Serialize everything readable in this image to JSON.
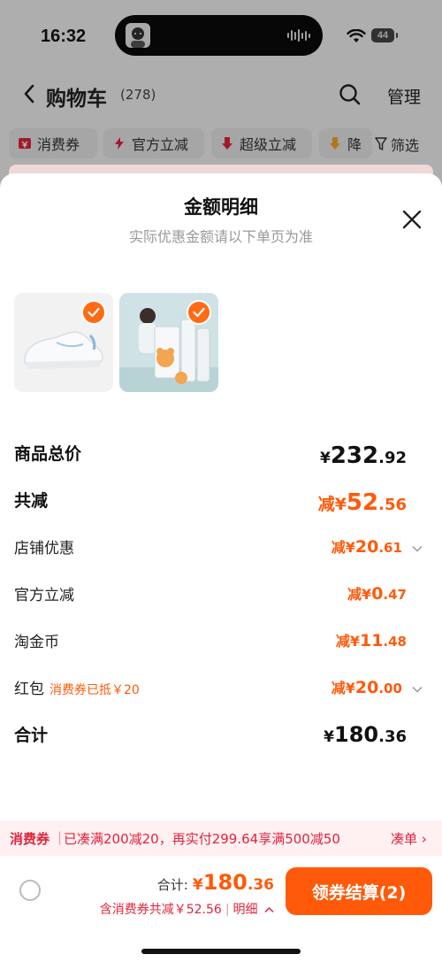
{
  "status_bar": {
    "time": "16:32",
    "battery": "44"
  },
  "nav": {
    "title": "购物车",
    "count": "(278)",
    "manage": "管理"
  },
  "filters": [
    {
      "label": "消费券",
      "icon": "coupon-icon",
      "color": "#e0243c"
    },
    {
      "label": "官方立减",
      "icon": "lightning-icon",
      "color": "#e0243c"
    },
    {
      "label": "超级立减",
      "icon": "down-arrow-icon",
      "color": "#e0243c"
    },
    {
      "label": "降",
      "icon": "price-drop-icon",
      "color": "#f5a623"
    }
  ],
  "filter_button": "筛选",
  "sheet": {
    "title": "金额明细",
    "subtitle": "实际优惠金额请以下单页为准",
    "rows": {
      "goods_total": {
        "label": "商品总价",
        "prefix": "¥",
        "int": "232",
        "dec": ".92"
      },
      "total_discount": {
        "label": "共减",
        "prefix": "减¥",
        "int": "52",
        "dec": ".56"
      },
      "store_discount": {
        "label": "店铺优惠",
        "prefix": "减¥",
        "int": "20",
        "dec": ".61"
      },
      "official_discount": {
        "label": "官方立减",
        "prefix": "减¥",
        "int": "0",
        "dec": ".47"
      },
      "taojinbi": {
        "label": "淘金币",
        "prefix": "减¥",
        "int": "11",
        "dec": ".48"
      },
      "red_packet": {
        "label": "红包",
        "note": "消费券已抵￥20",
        "prefix": "减¥",
        "int": "20",
        "dec": ".00"
      },
      "sum": {
        "label": "合计",
        "prefix": "¥",
        "int": "180",
        "dec": ".36"
      }
    }
  },
  "promo": {
    "tag": "消费券",
    "text": "已凑满200减20，再实付299.64享满500减50",
    "link": "凑单 ›"
  },
  "bottom": {
    "total_label": "合计:",
    "total_prefix": "¥",
    "total_int": "180",
    "total_dec": ".36",
    "discount_text": "含消费券共减￥52.56",
    "detail_label": "明细",
    "pay_button": "领券结算(2)"
  },
  "colors": {
    "accent": "#ff5a0a",
    "promo_red": "#e0243c"
  }
}
